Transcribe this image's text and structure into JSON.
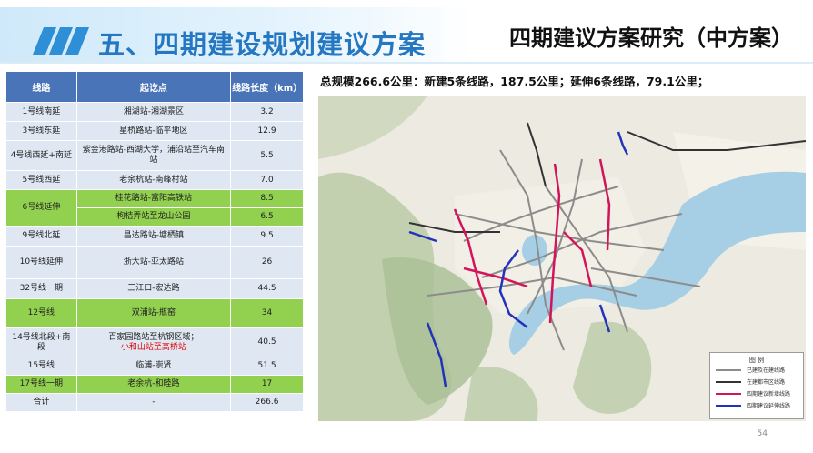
{
  "header": {
    "main_title": "五、四期建设规划建议方案",
    "sub_title": "四期建议方案研究（中方案）"
  },
  "table": {
    "headers": [
      "线路",
      "起讫点",
      "线路长度（km）"
    ],
    "rows": [
      {
        "line": "1号线南延",
        "range": "湘湖站-湘湖景区",
        "length": "3.2"
      },
      {
        "line": "3号线东延",
        "range": "星桥路站-临平地区",
        "length": "12.9"
      },
      {
        "line": "4号线西延+南延",
        "range": "紫金港路站-西湖大学，浦沿站至汽车南站",
        "length": "5.5"
      },
      {
        "line": "5号线西延",
        "range": "老余杭站-南峰村站",
        "length": "7.0"
      },
      {
        "line": "6号线延伸",
        "range": "桂花路站-富阳高铁站",
        "length": "8.5"
      },
      {
        "line": "",
        "range": "枸桔弄站至龙山公园",
        "length": "6.5"
      },
      {
        "line": "9号线北延",
        "range": "昌达路站-塘栖镇",
        "length": "9.5"
      },
      {
        "line": "10号线延伸",
        "range": "浙大站-亚太路站",
        "length": "26"
      },
      {
        "line": "32号线一期",
        "range": "三江口-宏达路",
        "length": "44.5"
      },
      {
        "line": "12号线",
        "range": "双浦站-瓶窑",
        "length": "34"
      },
      {
        "line": "14号线北段+南段",
        "range": "百家园路站至杭钢区域；",
        "range_red": "小和山站至高桥站",
        "length": "40.5"
      },
      {
        "line": "15号线",
        "range": "临浦-崇贤",
        "length": "51.5"
      },
      {
        "line": "17号线一期",
        "range": "老余杭-和睦路",
        "length": "17"
      },
      {
        "line": "合计",
        "range": "-",
        "length": "266.6"
      }
    ]
  },
  "summary": "总规模266.6公里：新建5条线路，187.5公里；延伸6条线路，79.1公里；",
  "legend": {
    "title": "图 例",
    "items": [
      {
        "label": "已建及在建线路",
        "color": "#8c8c8c"
      },
      {
        "label": "在建都市区线路",
        "color": "#333333"
      },
      {
        "label": "四期建议新增线路",
        "color": "#d4145a"
      },
      {
        "label": "四期建议延伸线路",
        "color": "#2233bb"
      }
    ]
  },
  "colors": {
    "header_blue": "#4a74b8",
    "row_blue": "#dfe7f3",
    "row_green": "#92d050",
    "title_blue": "#2477c0"
  },
  "page_number": "54"
}
